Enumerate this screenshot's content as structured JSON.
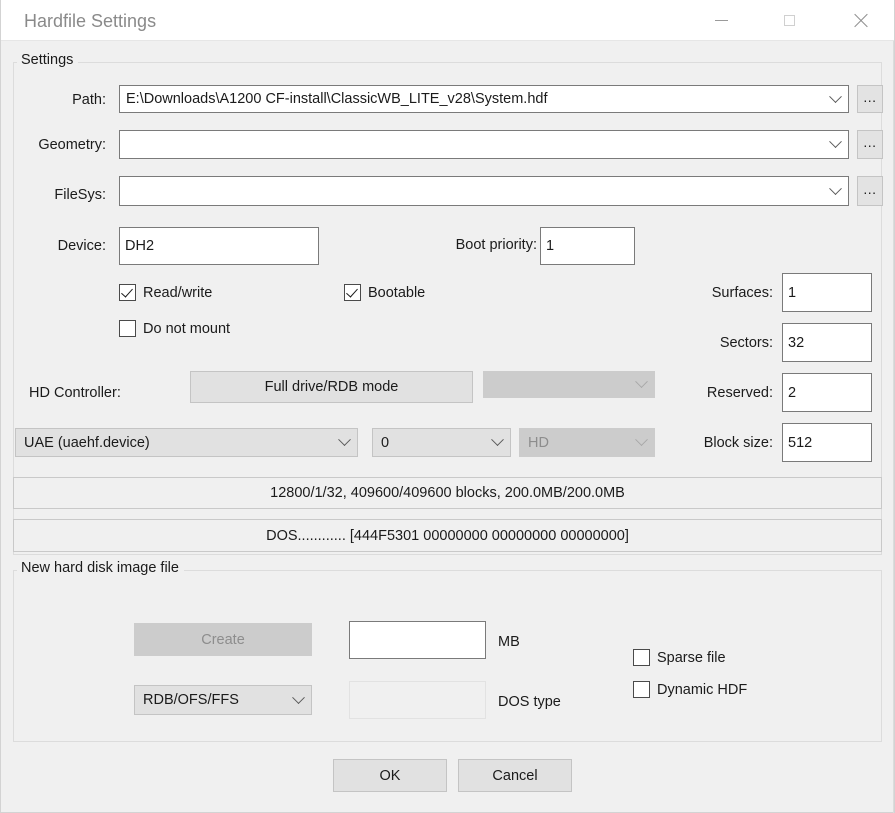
{
  "window": {
    "title": "Hardfile Settings",
    "controls": {
      "minimize": "minimize-icon",
      "maximize": "maximize-icon",
      "close": "close-icon"
    }
  },
  "settings_group": {
    "legend": "Settings",
    "path": {
      "label": "Path:",
      "value": "E:\\Downloads\\A1200 CF-install\\ClassicWB_LITE_v28\\System.hdf",
      "browse_label": "...",
      "placeholder": ""
    },
    "geometry": {
      "label": "Geometry:",
      "value": "",
      "browse_label": "...",
      "placeholder": ""
    },
    "filesys": {
      "label": "FileSys:",
      "value": "",
      "browse_label": "...",
      "placeholder": ""
    },
    "device": {
      "label": "Device:",
      "value": "DH2"
    },
    "boot_priority": {
      "label": "Boot priority:",
      "value": "1"
    },
    "checkboxes": [
      {
        "name": "read-write",
        "label": "Read/write",
        "checked": true
      },
      {
        "name": "bootable",
        "label": "Bootable",
        "checked": true
      },
      {
        "name": "do-not-mount",
        "label": "Do not mount",
        "checked": false
      }
    ],
    "surfaces": {
      "label": "Surfaces:",
      "value": "1"
    },
    "sectors": {
      "label": "Sectors:",
      "value": "32"
    },
    "reserved": {
      "label": "Reserved:",
      "value": "2"
    },
    "block_size": {
      "label": "Block size:",
      "value": "512"
    },
    "hd_controller": {
      "label": "HD Controller:",
      "mode_button": "Full drive/RDB mode",
      "mode_extra_combo": "",
      "device_combo": "UAE (uaehf.device)",
      "unit_combo": "0",
      "type_combo": "HD"
    },
    "info_geometry": "12800/1/32, 409600/409600 blocks, 200.0MB/200.0MB",
    "info_dostype": "DOS............ [444F5301 00000000 00000000 00000000]"
  },
  "new_image_group": {
    "legend": "New hard disk image file",
    "create_button": "Create",
    "size_value": "",
    "size_unit_label": "MB",
    "format_combo": "RDB/OFS/FFS",
    "dostype_value": "",
    "dostype_label": "DOS type",
    "checkboxes": [
      {
        "name": "sparse-file",
        "label": "Sparse file",
        "checked": false
      },
      {
        "name": "dynamic-hdf",
        "label": "Dynamic HDF",
        "checked": false
      }
    ]
  },
  "footer": {
    "ok_label": "OK",
    "cancel_label": "Cancel"
  },
  "colors": {
    "window_bg": "#f0f0f0",
    "titlebar_bg": "#ffffff",
    "title_text": "#8a8a8a",
    "field_bg": "#ffffff",
    "field_border": "#7a7a7a",
    "button_bg": "#e1e1e1",
    "button_border": "#c4c4c4",
    "disabled_bg": "#cccccc",
    "disabled_text": "#8d8d8d",
    "group_border": "#dcdcdc",
    "text": "#1b1b1b"
  }
}
